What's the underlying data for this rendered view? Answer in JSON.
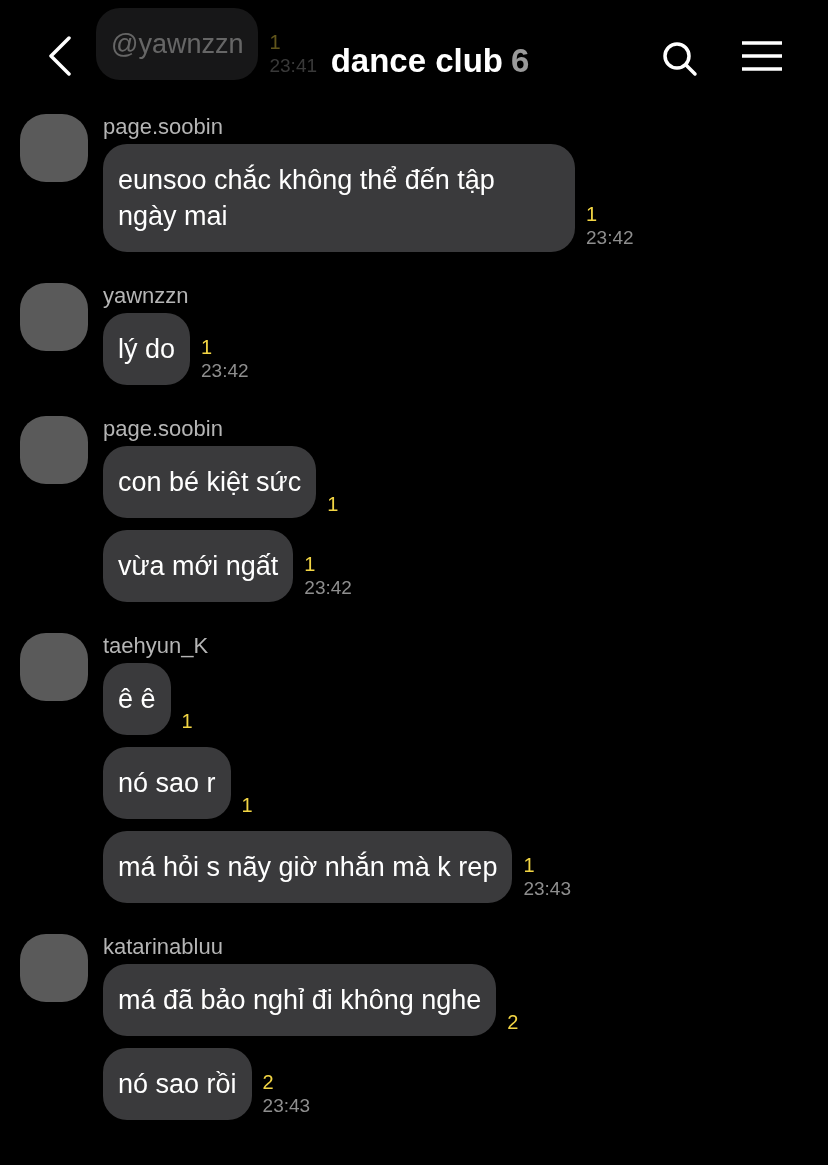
{
  "header": {
    "title": "dance club",
    "member_count": "6"
  },
  "faded_message": {
    "text": "@yawnzzn",
    "unread": "1",
    "time": "23:41"
  },
  "groups": [
    {
      "sender": "page.soobin",
      "messages": [
        {
          "text": "eunsoo chắc không thể đến tập ngày mai",
          "unread": "1",
          "time": "23:42"
        }
      ]
    },
    {
      "sender": "yawnzzn",
      "messages": [
        {
          "text": "lý do",
          "unread": "1",
          "time": "23:42"
        }
      ]
    },
    {
      "sender": "page.soobin",
      "messages": [
        {
          "text": "con bé kiệt sức",
          "unread": "1"
        },
        {
          "text": "vừa mới ngất",
          "unread": "1",
          "time": "23:42"
        }
      ]
    },
    {
      "sender": "taehyun_K",
      "messages": [
        {
          "text": "ê ê",
          "unread": "1"
        },
        {
          "text": "nó sao r",
          "unread": "1"
        },
        {
          "text": "má hỏi s nãy giờ nhắn mà k rep",
          "unread": "1",
          "time": "23:43"
        }
      ]
    },
    {
      "sender": "katarinabluu",
      "messages": [
        {
          "text": "má đã bảo nghỉ đi không nghe",
          "unread": "2"
        },
        {
          "text": "nó sao rồi",
          "unread": "2",
          "time": "23:43"
        }
      ]
    }
  ]
}
